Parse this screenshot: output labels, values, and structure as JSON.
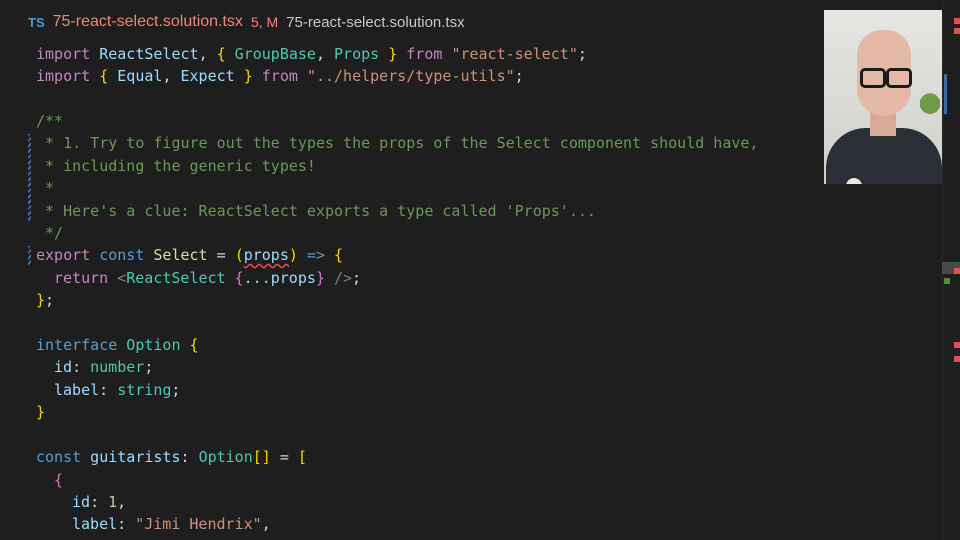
{
  "tab": {
    "lang_badge": "TS",
    "filename": "75-react-select.solution.tsx",
    "status": "5, M",
    "path": "75-react-select.solution.tsx"
  },
  "code": {
    "l1": {
      "a": "import",
      "b": "ReactSelect",
      "c": ", ",
      "d": "{",
      "e": " GroupBase",
      "f": ", ",
      "g": "Props",
      "h": " ",
      "i": "}",
      "j": " from ",
      "k": "\"react-select\"",
      "l": ";"
    },
    "l2": {
      "a": "import",
      "b": " ",
      "c": "{",
      "d": " Equal",
      "e": ", ",
      "f": "Expect",
      "g": " ",
      "h": "}",
      "i": " from ",
      "j": "\"../helpers/type-utils\"",
      "k": ";"
    },
    "c1": "/**",
    "c2": " * 1. Try to figure out the types the props of the Select component should have,",
    "c3": " * including the generic types!",
    "c4": " *",
    "c5": " * Here's a clue: ReactSelect exports a type called 'Props'...",
    "c6": " */",
    "l9": {
      "a": "export",
      "b": " const ",
      "c": "Select",
      "d": " = ",
      "e": "(",
      "f": "props",
      "g": ")",
      "h": " => ",
      "i": "{"
    },
    "l10": {
      "a": "return",
      "b": " <",
      "c": "ReactSelect",
      "d": " {",
      "e": "...props",
      "f": "}",
      "g": " />",
      "h": ";"
    },
    "l11": {
      "a": "}",
      "b": ";"
    },
    "l13": {
      "a": "interface",
      "b": " Option ",
      "c": "{"
    },
    "l14": {
      "a": "id",
      "b": ": ",
      "c": "number",
      "d": ";"
    },
    "l15": {
      "a": "label",
      "b": ": ",
      "c": "string",
      "d": ";"
    },
    "l16": {
      "a": "}"
    },
    "l18": {
      "a": "const",
      "b": " guitarists",
      "c": ": ",
      "d": "Option",
      "e": "[]",
      "f": " = ",
      "g": "["
    },
    "l19": {
      "a": "{"
    },
    "l20": {
      "a": "id",
      "b": ": ",
      "c": "1",
      "d": ","
    },
    "l21": {
      "a": "label",
      "b": ": ",
      "c": "\"Jimi Hendrix\"",
      "d": ","
    }
  },
  "colors": {
    "keyword_purple": "#c586c0",
    "keyword_blue": "#569cd6",
    "type_teal": "#4ec9b0",
    "string_orange": "#ce9178",
    "comment_green": "#6a9955",
    "error_red": "#f14c4c"
  }
}
